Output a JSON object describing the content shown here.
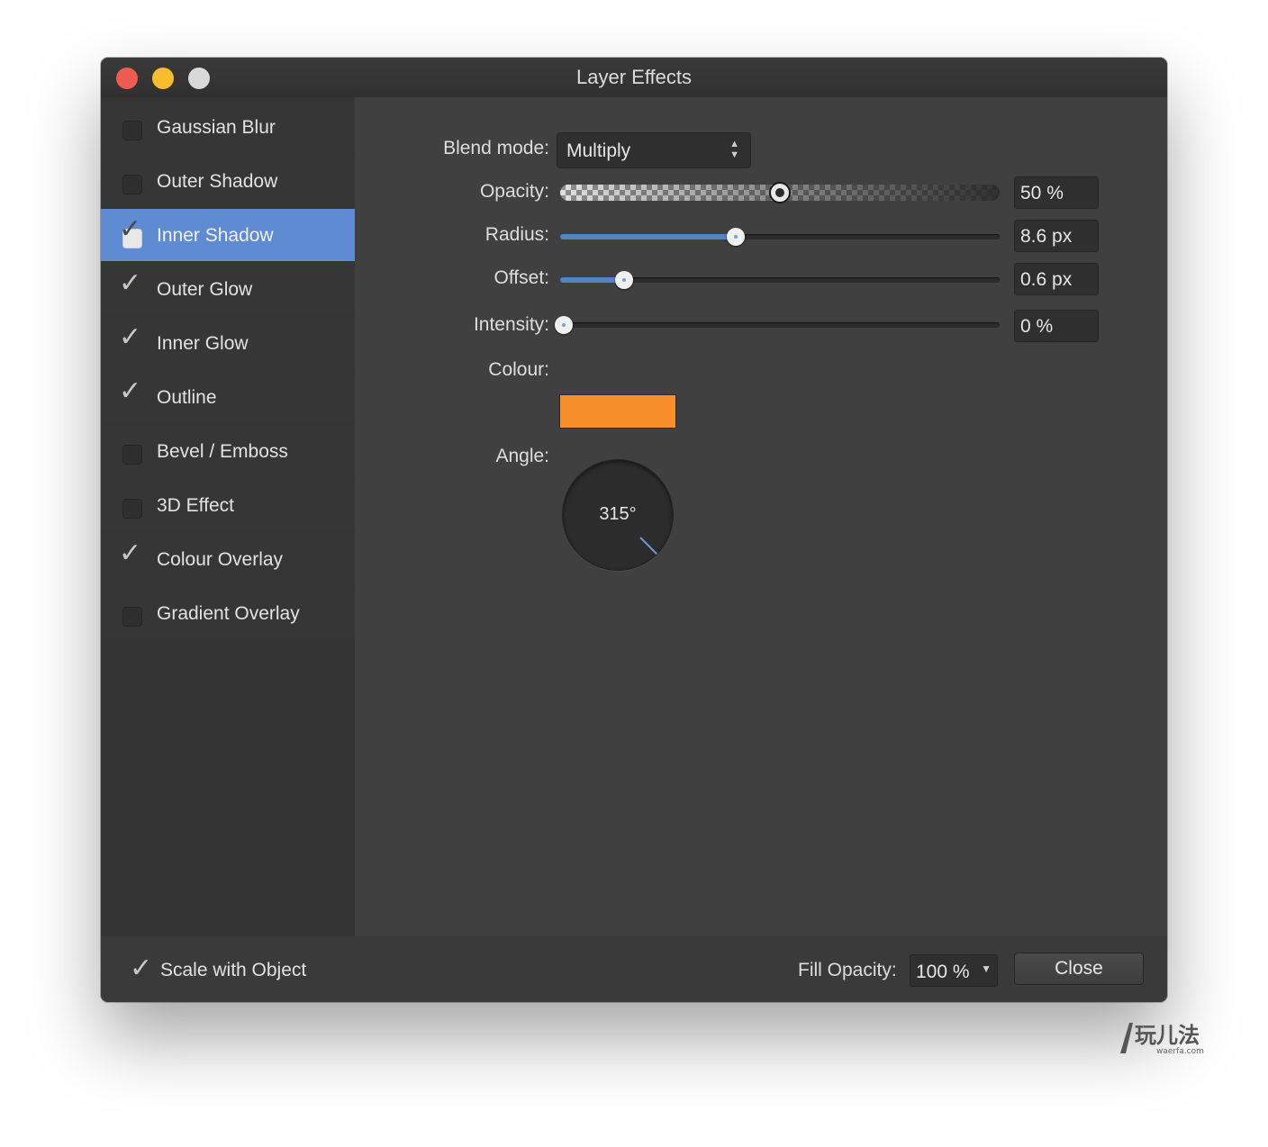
{
  "window": {
    "title": "Layer Effects"
  },
  "sidebar": {
    "items": [
      {
        "label": "Gaussian Blur",
        "checked": false,
        "selected": false
      },
      {
        "label": "Outer Shadow",
        "checked": false,
        "selected": false
      },
      {
        "label": "Inner Shadow",
        "checked": true,
        "selected": true
      },
      {
        "label": "Outer Glow",
        "checked": true,
        "selected": false
      },
      {
        "label": "Inner Glow",
        "checked": true,
        "selected": false
      },
      {
        "label": "Outline",
        "checked": true,
        "selected": false
      },
      {
        "label": "Bevel / Emboss",
        "checked": false,
        "selected": false
      },
      {
        "label": "3D Effect",
        "checked": false,
        "selected": false
      },
      {
        "label": "Colour Overlay",
        "checked": true,
        "selected": false
      },
      {
        "label": "Gradient Overlay",
        "checked": false,
        "selected": false
      }
    ]
  },
  "panel": {
    "blend_mode": {
      "label": "Blend mode:",
      "value": "Multiply"
    },
    "opacity": {
      "label": "Opacity:",
      "value": "50 %",
      "level": 0.5
    },
    "radius": {
      "label": "Radius:",
      "value": "8.6 px",
      "level": 0.4
    },
    "offset": {
      "label": "Offset:",
      "value": "0.6 px",
      "level": 0.145
    },
    "intensity": {
      "label": "Intensity:",
      "value": "0 %",
      "level": 0.0
    },
    "colour": {
      "label": "Colour:",
      "hex": "#f7902a"
    },
    "angle": {
      "label": "Angle:",
      "value": "315°",
      "degrees": 315
    }
  },
  "footer": {
    "scale_with_object": {
      "label": "Scale with Object",
      "checked": true
    },
    "fill_opacity": {
      "label": "Fill Opacity:",
      "value": "100 %"
    },
    "close_label": "Close"
  },
  "colors": {
    "accent": "#5e8bd2",
    "slider_fill": "#5583c8",
    "window_bg": "#404040"
  },
  "icons": {
    "close": "close-traffic-light-icon",
    "minimize": "minimize-traffic-light-icon",
    "zoom": "zoom-traffic-light-icon",
    "check": "checkmark-icon"
  }
}
